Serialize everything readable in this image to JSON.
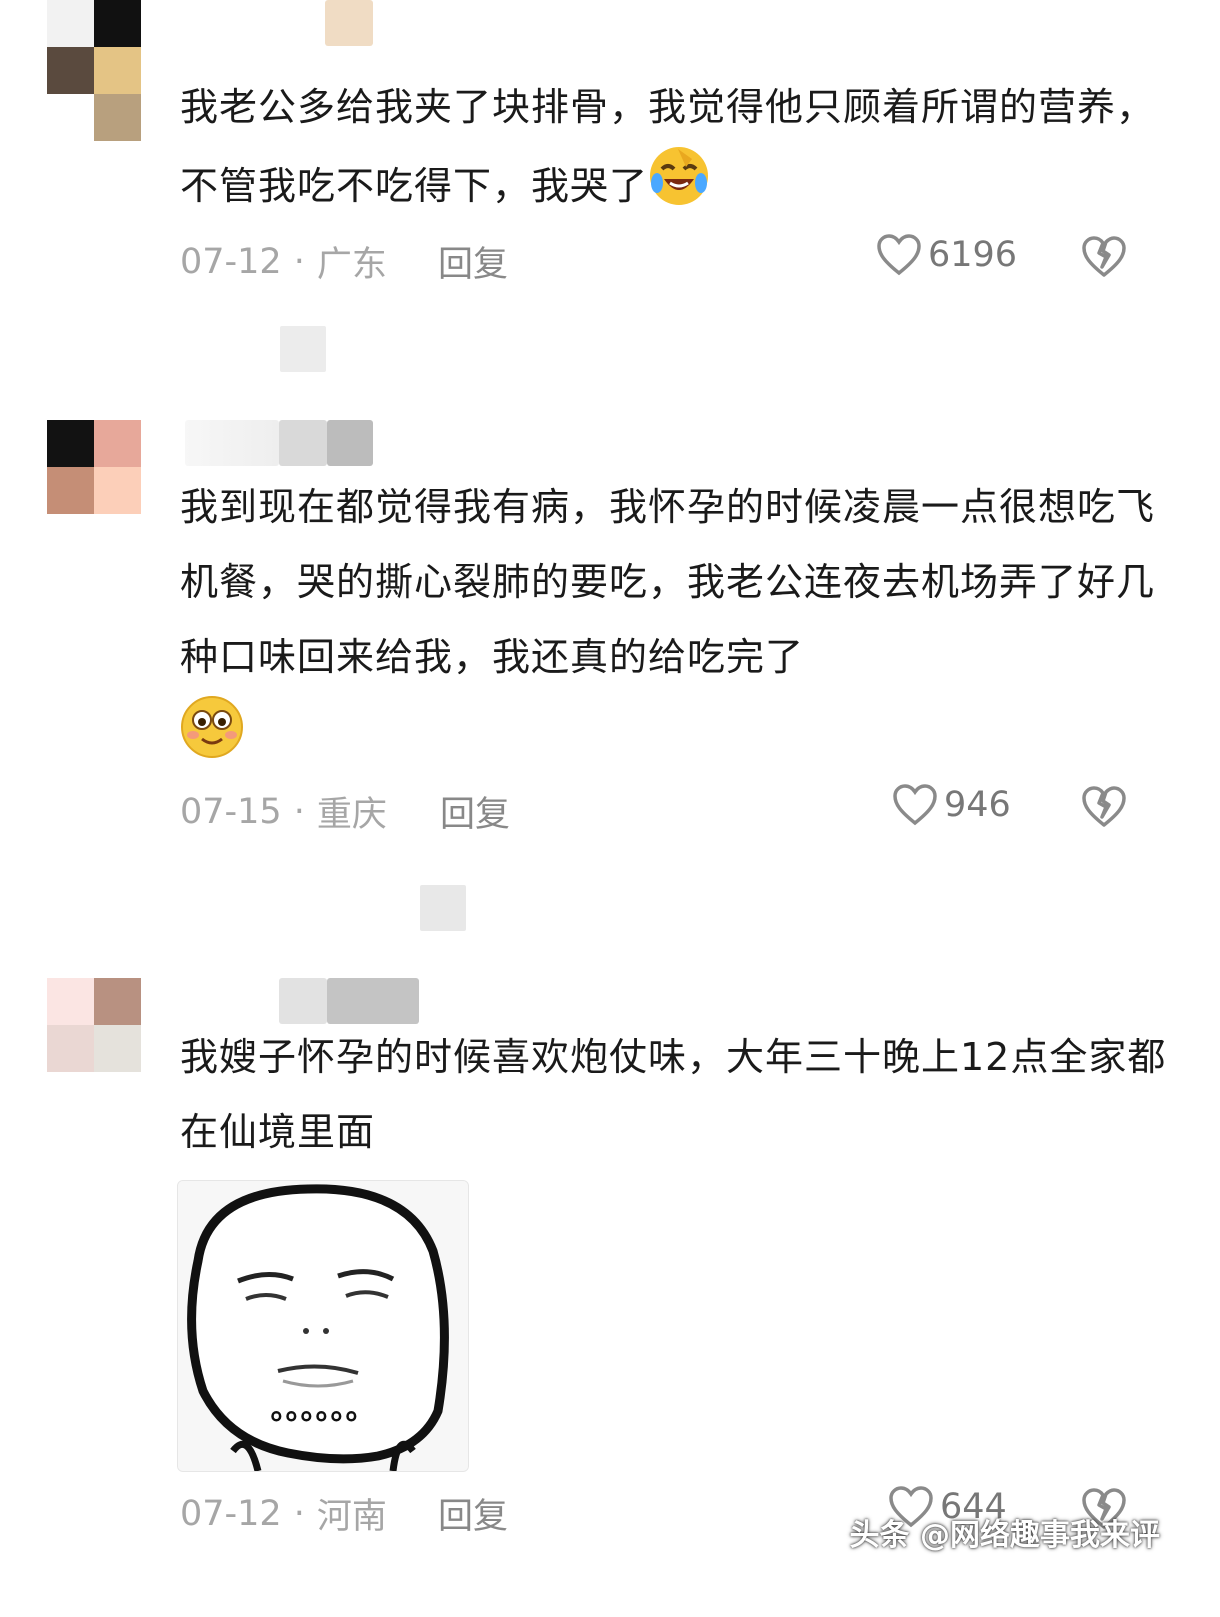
{
  "colors": {
    "meta": "#a6a6a6",
    "text": "#1a1a1a",
    "icon": "#8a8a8a"
  },
  "comments": [
    {
      "text": "我老公多给我夹了块排骨，我觉得他只顾着所谓的营养，不管我吃不吃得下，我哭了",
      "emoji": "laugh-crying-emoji",
      "date": "07-12",
      "region": "广东",
      "reply": "回复",
      "likes": "6196"
    },
    {
      "text": "我到现在都觉得我有病，我怀孕的时候凌晨一点很想吃飞机餐，哭的撕心裂肺的要吃，我老公连夜去机场弄了好几种口味回来给我，我还真的给吃完了",
      "emoji": "smile-emoji",
      "date": "07-15",
      "region": "重庆",
      "reply": "回复",
      "likes": "946"
    },
    {
      "text": "我嫂子怀孕的时候喜欢炮仗味，大年三十晚上12点全家都在仙境里面",
      "sticker_text": "。。。。。。",
      "date": "07-12",
      "region": "河南",
      "reply": "回复",
      "likes": "644"
    }
  ],
  "separator": "·",
  "watermark": "头条 @网络趣事我来评"
}
